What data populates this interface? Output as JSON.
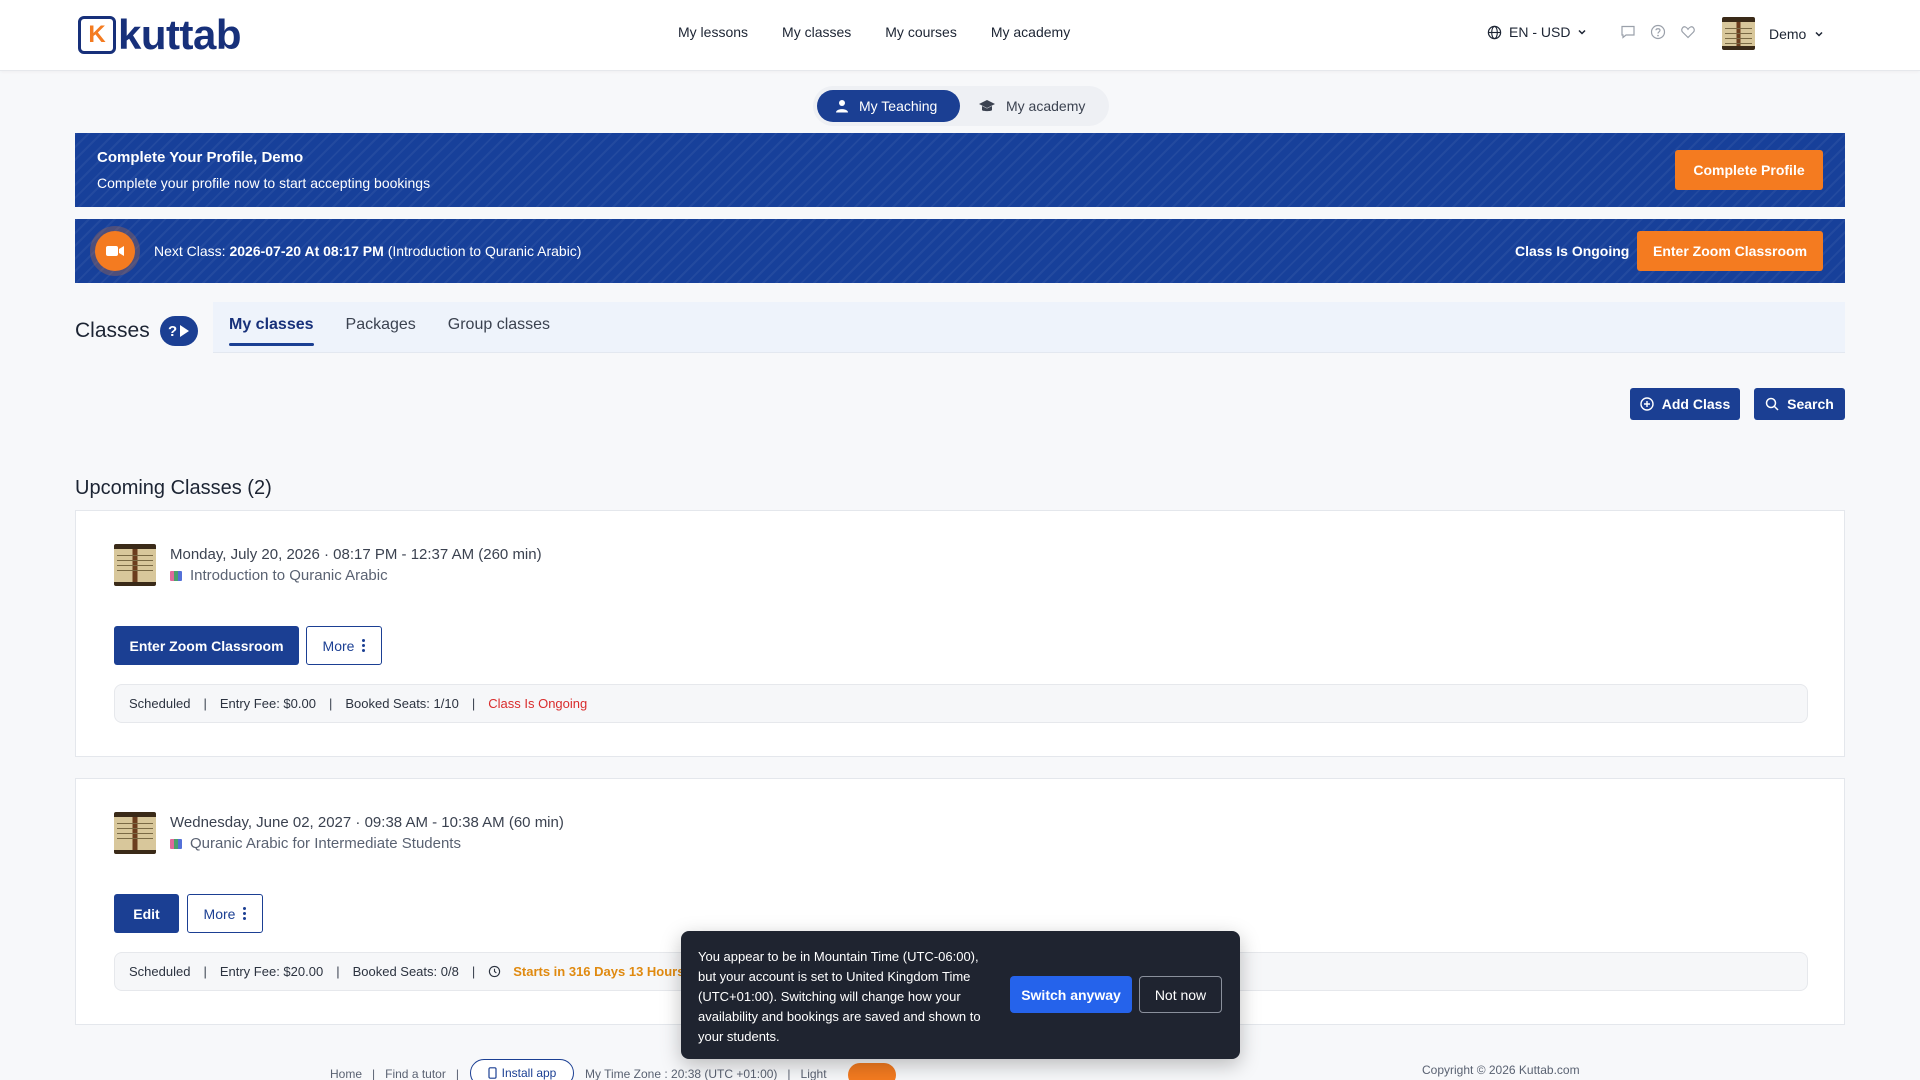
{
  "header": {
    "logo_text": "kuttab",
    "logo_letter": "K",
    "nav": [
      "My lessons",
      "My classes",
      "My courses",
      "My academy"
    ],
    "language": "EN - USD",
    "user_name": "Demo"
  },
  "mode_toggle": {
    "active": "My Teaching",
    "inactive": "My academy"
  },
  "profile_banner": {
    "title": "Complete Your Profile, Demo",
    "subtitle": "Complete your profile now to start accepting bookings",
    "button": "Complete Profile"
  },
  "next_class_banner": {
    "prefix": "Next Class:",
    "datetime": "2026-07-20 At 08:17 PM",
    "course": "(Introduction to Quranic Arabic)",
    "status": "Class Is Ongoing",
    "button": "Enter Zoom Classroom"
  },
  "classes": {
    "title": "Classes",
    "tabs": [
      "My classes",
      "Packages",
      "Group classes"
    ],
    "add_button": "Add Class",
    "search_button": "Search",
    "upcoming_title": "Upcoming Classes (2)"
  },
  "cards": [
    {
      "date": "Monday, July 20, 2026",
      "time": "08:17 PM - 12:37 AM (260 min)",
      "course": "Introduction to Quranic Arabic",
      "primary_button": "Enter Zoom Classroom",
      "more_button": "More",
      "status": "Scheduled",
      "fee": "Entry Fee: $0.00",
      "seats": "Booked Seats: 1/10",
      "note": "Class Is Ongoing"
    },
    {
      "date": "Wednesday, June 02, 2027",
      "time": "09:38 AM - 10:38 AM (60 min)",
      "course": "Quranic Arabic for Intermediate Students",
      "primary_button": "Edit",
      "more_button": "More",
      "status": "Scheduled",
      "fee": "Entry Fee: $20.00",
      "seats": "Booked Seats: 0/8",
      "note": "Starts in 316 Days 13 Hours"
    }
  ],
  "tz_popup": {
    "message": "You appear to be in Mountain Time (UTC-06:00), but your account is set to United Kingdom Time (UTC+01:00). Switching will change how your availability and bookings are saved and shown to your students.",
    "switch_button": "Switch anyway",
    "dismiss_button": "Not now"
  },
  "footer": {
    "home": "Home",
    "find_tutor": "Find a tutor",
    "install": "Install app",
    "timezone": "My Time Zone : 20:38 (UTC +01:00)",
    "theme": "Light",
    "copyright": "Copyright © 2026 Kuttab.com"
  },
  "colors": {
    "brand_blue": "#1b3f93",
    "banner_blue": "#17409a",
    "accent_orange": "#f47b20",
    "ongoing_red": "#d92c2c",
    "popup_bg": "#1f2430"
  }
}
